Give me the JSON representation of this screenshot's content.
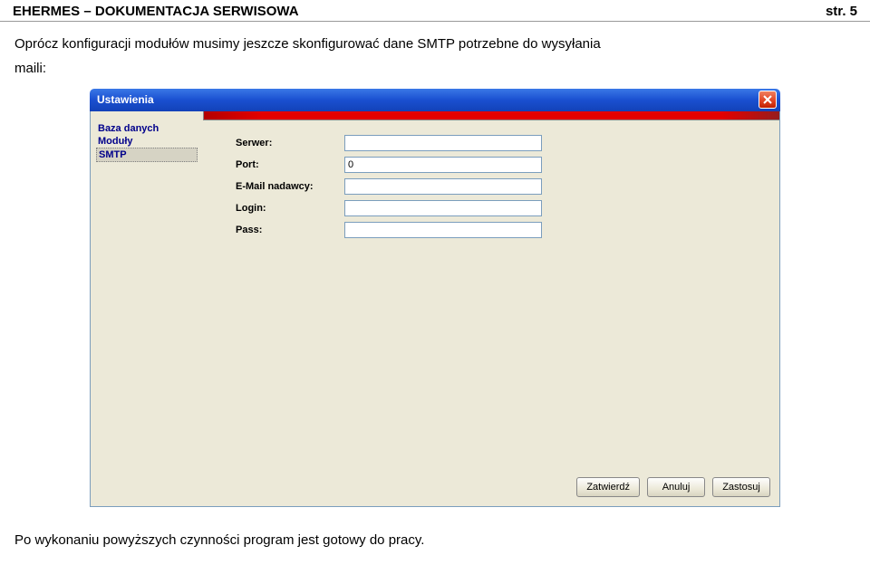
{
  "header": {
    "title": "EHERMES – DOKUMENTACJA SERWISOWA",
    "page_label": "str. 5"
  },
  "intro": {
    "line1": "Oprócz konfiguracji modułów musimy jeszcze skonfigurować dane SMTP potrzebne do wysyłania",
    "line2": "maili:"
  },
  "window": {
    "title": "Ustawienia",
    "sidebar": {
      "items": [
        {
          "label": "Baza danych",
          "selected": false
        },
        {
          "label": "Moduły",
          "selected": false
        },
        {
          "label": "SMTP",
          "selected": true
        }
      ]
    },
    "form": {
      "rows": [
        {
          "label": "Serwer:",
          "value": "",
          "name": "server"
        },
        {
          "label": "Port:",
          "value": "0",
          "name": "port"
        },
        {
          "label": "E-Mail nadawcy:",
          "value": "",
          "name": "sender-email"
        },
        {
          "label": "Login:",
          "value": "",
          "name": "login"
        },
        {
          "label": "Pass:",
          "value": "",
          "name": "pass"
        }
      ]
    },
    "buttons": {
      "confirm": "Zatwierdź",
      "cancel": "Anuluj",
      "apply": "Zastosuj"
    }
  },
  "outro": "Po wykonaniu powyższych czynności program jest gotowy do pracy."
}
